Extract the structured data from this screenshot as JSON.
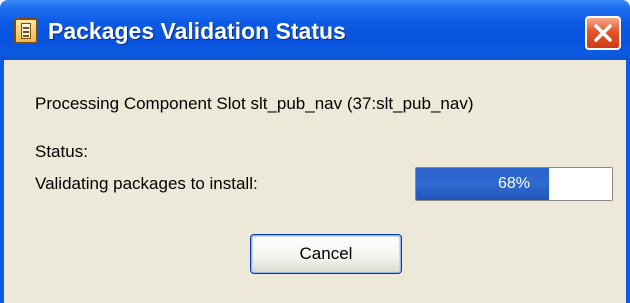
{
  "window": {
    "title": "Packages Validation Status",
    "title_icon": "package-icon",
    "close_icon": "close-icon"
  },
  "dialog": {
    "processing_text": "Processing Component Slot slt_pub_nav (37:slt_pub_nav)",
    "status_label": "Status:",
    "validating_text": "Validating packages to install:"
  },
  "progress": {
    "value": 68,
    "label": "68%"
  },
  "buttons": {
    "cancel_label": "Cancel"
  },
  "colors": {
    "title_bar": "#0852de",
    "close_button": "#e4542d",
    "client_background": "#ece9d8",
    "progress_fill": "#2f6ad2"
  }
}
